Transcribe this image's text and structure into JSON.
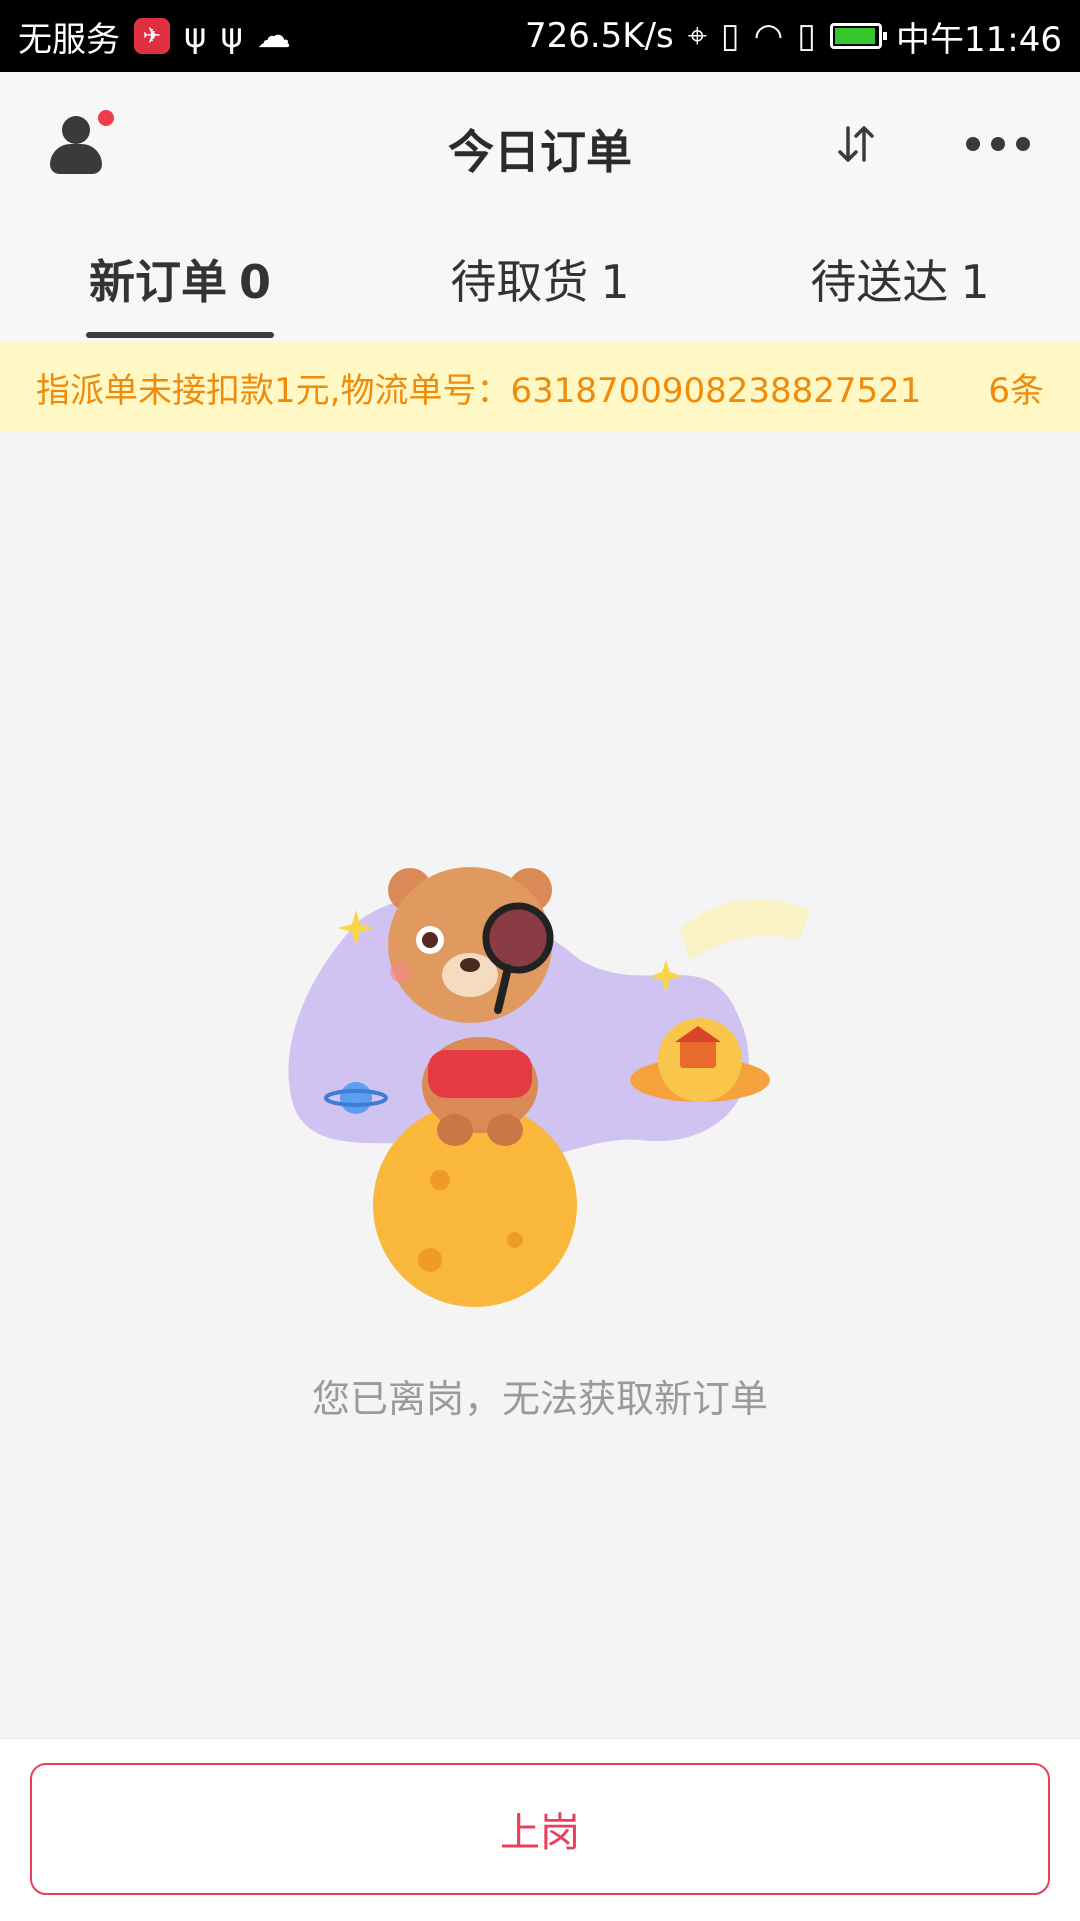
{
  "status_bar": {
    "carrier": "无服务",
    "net_speed": "726.5K/s",
    "time": "中午11:46",
    "battery_color": "#36c52c"
  },
  "header": {
    "title": "今日订单",
    "avatar_badge_color": "#f23b4b"
  },
  "tabs": [
    {
      "label": "新订单",
      "count": "0",
      "active": true
    },
    {
      "label": "待取货",
      "count": "1",
      "active": false
    },
    {
      "label": "待送达",
      "count": "1",
      "active": false
    }
  ],
  "notice": {
    "message": "指派单未接扣款1元,物流单号：6318700908238827521",
    "count": "6条",
    "text_color": "#ef8b0b",
    "background": "#fff7c4"
  },
  "empty_state": {
    "message": "您已离岗，无法获取新订单"
  },
  "bottom": {
    "button_label": "上岗",
    "accent_color": "#e8405a"
  }
}
